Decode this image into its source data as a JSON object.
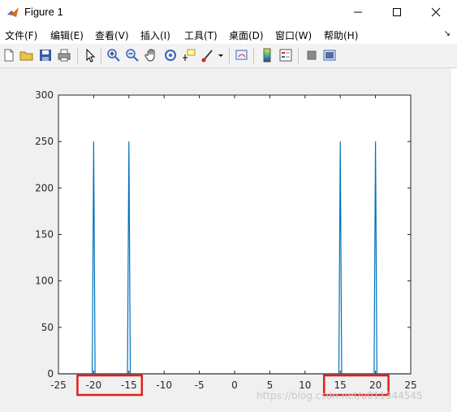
{
  "window": {
    "title": "Figure 1"
  },
  "menu": [
    "文件(F)",
    "编辑(E)",
    "查看(V)",
    "插入(I)",
    "工具(T)",
    "桌面(D)",
    "窗口(W)",
    "帮助(H)"
  ],
  "toolbar": {
    "icons": [
      "new-figure-icon",
      "open-file-icon",
      "save-icon",
      "print-icon",
      "select-arrow-icon",
      "zoom-in-icon",
      "zoom-out-icon",
      "pan-hand-icon",
      "rotate-3d-icon",
      "data-cursor-icon",
      "brush-icon",
      "brush-dropdown-icon",
      "link-plot-icon",
      "colorbar-icon",
      "legend-icon",
      "hide-plot-tools-icon",
      "show-plot-tools-icon"
    ]
  },
  "chart_data": {
    "type": "line",
    "title": "",
    "xlabel": "",
    "ylabel": "",
    "xlim": [
      -25,
      25
    ],
    "ylim": [
      0,
      300
    ],
    "xticks": [
      "-25",
      "-20",
      "-15",
      "-10",
      "-5",
      "0",
      "5",
      "10",
      "15",
      "20",
      "25"
    ],
    "yticks": [
      "0",
      "50",
      "100",
      "150",
      "200",
      "250",
      "300"
    ],
    "series": [
      {
        "color": "#0072bd",
        "x": [
          -25,
          -20.2,
          -20,
          -19.8,
          -15.2,
          -15,
          -14.8,
          14.8,
          15,
          15.2,
          19.8,
          20,
          20.2,
          25
        ],
        "y": [
          0,
          0,
          250,
          0,
          0,
          250,
          0,
          0,
          250,
          0,
          0,
          250,
          0,
          0
        ]
      }
    ],
    "highlight_boxes": [
      {
        "ticks": [
          "-20",
          "-15"
        ],
        "color": "#e02020"
      },
      {
        "ticks": [
          "15",
          "20"
        ],
        "color": "#e02020"
      }
    ],
    "grid": false
  },
  "watermark": "https://blog.csdn.net/u011344545"
}
